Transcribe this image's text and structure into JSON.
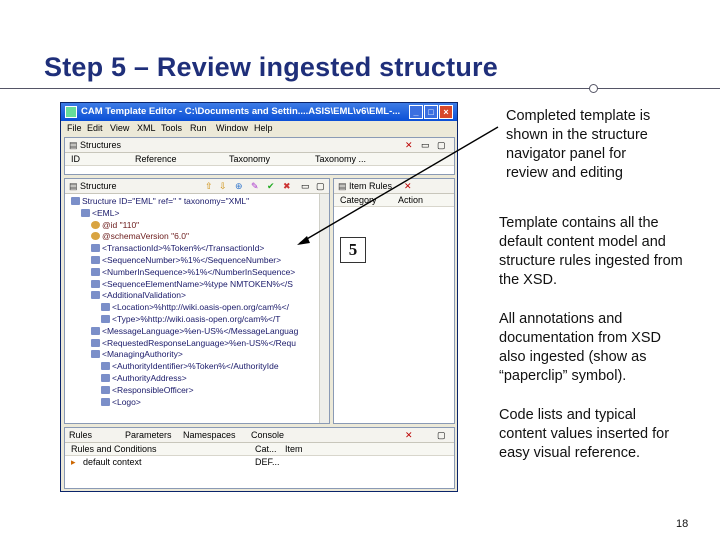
{
  "slide": {
    "title": "Step 5 – Review ingested structure",
    "page_number": "18",
    "marker": "5"
  },
  "notes": [
    {
      "lines": [
        "Completed template is",
        "shown in the structure",
        "navigator panel for",
        "review and editing"
      ]
    },
    {
      "lines": [
        "Template contains all the",
        "default content model and",
        "structure rules ingested from",
        "the XSD."
      ]
    },
    {
      "lines": [
        "All annotations and",
        "documentation from XSD",
        "also ingested (show as",
        "“paperclip” symbol)."
      ]
    },
    {
      "lines": [
        "Code lists and typical",
        "content values inserted for",
        "easy visual reference."
      ]
    }
  ],
  "window": {
    "title": "CAM Template Editor - C:\\Documents and Settin....ASIS\\EML\\v6\\EML-...",
    "menu": [
      "File",
      "Edit",
      "View",
      "XML",
      "Tools",
      "Run",
      "Window",
      "Help"
    ],
    "structures_panel": {
      "tab": "Structures",
      "columns": [
        "ID",
        "Reference",
        "Taxonomy",
        "Taxonomy ..."
      ]
    },
    "structure_panel": {
      "tab": "Structure",
      "rows": [
        {
          "indent": 0,
          "text": "Structure ID=\"EML\" ref=\" \" taxonomy=\"XML\""
        },
        {
          "indent": 1,
          "text": "<EML>"
        },
        {
          "indent": 2,
          "text": "@id    \"110\""
        },
        {
          "indent": 2,
          "text": "@schemaVersion    \"6.0\""
        },
        {
          "indent": 2,
          "text": "<TransactionId>%Token%</TransactionId>"
        },
        {
          "indent": 2,
          "text": "<SequenceNumber>%1%</SequenceNumber>"
        },
        {
          "indent": 2,
          "text": "<NumberInSequence>%1%</NumberInSequence>"
        },
        {
          "indent": 2,
          "text": "<SequenceElementName>%type  NMTOKEN%</S"
        },
        {
          "indent": 2,
          "text": "<AdditionalValidation>"
        },
        {
          "indent": 3,
          "text": "<Location>%http://wiki.oasis-open.org/cam%</"
        },
        {
          "indent": 3,
          "text": "<Type>%http://wiki.oasis-open.org/cam%</T"
        },
        {
          "indent": 2,
          "text": "<MessageLanguage>%en-US%</MessageLanguag"
        },
        {
          "indent": 2,
          "text": "<RequestedResponseLanguage>%en-US%</Requ"
        },
        {
          "indent": 2,
          "text": "<ManagingAuthority>"
        },
        {
          "indent": 3,
          "text": "<AuthorityIdentifier>%Token%</AuthorityIde"
        },
        {
          "indent": 3,
          "text": "<AuthorityAddress>"
        },
        {
          "indent": 3,
          "text": "<ResponsibleOfficer>"
        },
        {
          "indent": 3,
          "text": "<Logo>"
        }
      ]
    },
    "item_rules_panel": {
      "tab": "Item Rules",
      "columns": [
        "Category",
        "Action"
      ]
    },
    "bottom_panel": {
      "tabs": [
        "Rules",
        "Parameters",
        "Namespaces",
        "Console"
      ],
      "columns": [
        "Rules and Conditions",
        "Cat...",
        "Item"
      ],
      "rows": [
        {
          "name": "default context",
          "cat": "DEF...",
          "item": ""
        }
      ]
    }
  }
}
